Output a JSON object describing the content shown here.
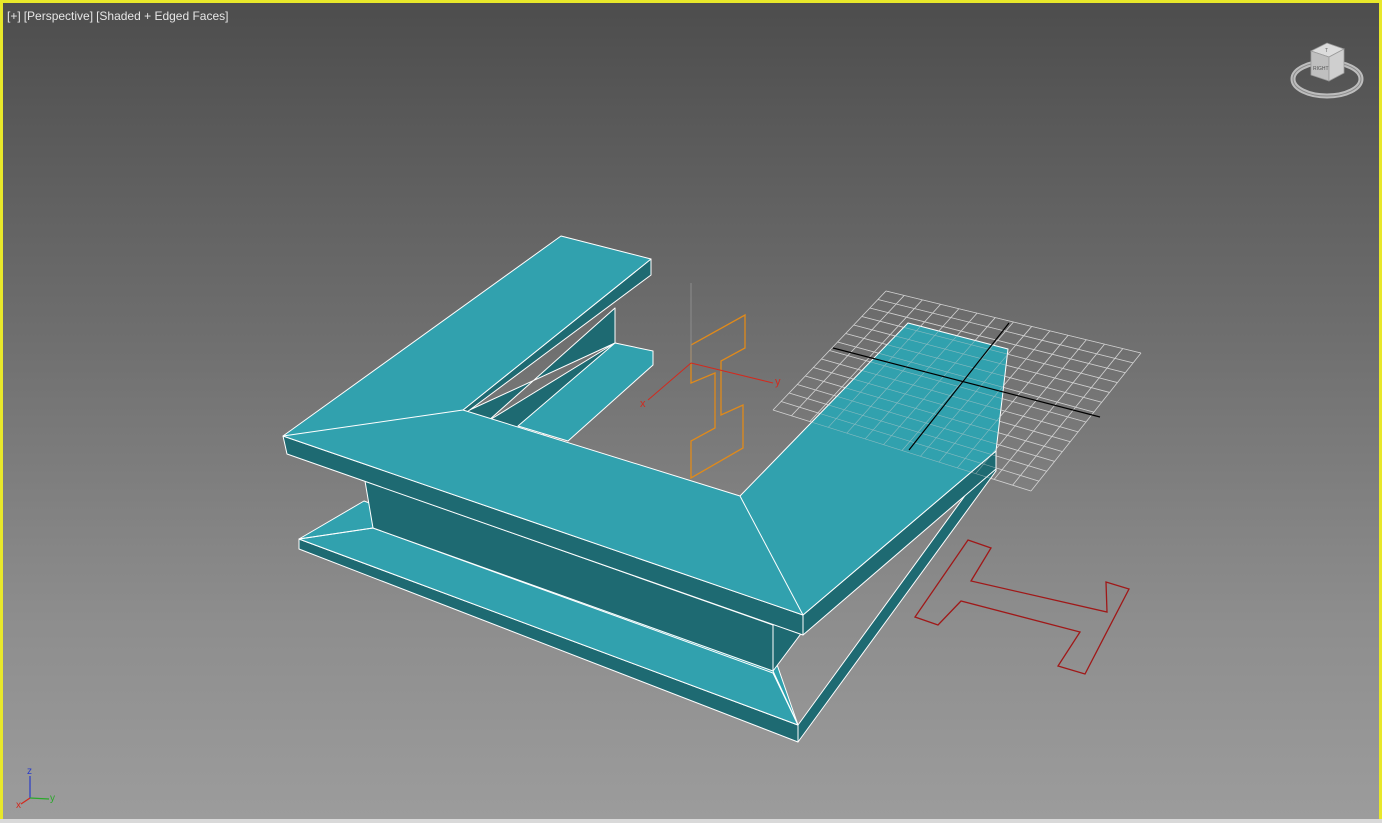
{
  "viewport": {
    "labels": {
      "menu": "[+]",
      "view": "[Perspective]",
      "shading": "[Shaded + Edged Faces]"
    },
    "border_color": "#e8e82a",
    "active": true
  },
  "viewcube": {
    "face_label": "RIGHT",
    "top_label": "T"
  },
  "axis_tripod": {
    "x": "x",
    "y": "y",
    "z": "z"
  },
  "scene": {
    "object_color": "#31a1ae",
    "object_dark_color": "#1e6a72",
    "edge_color": "#ffffff",
    "gizmo_x_color": "#d22a1e",
    "gizmo_y_color": "#d22a1e",
    "profile_selected_color": "#e08a1a",
    "profile_shape_color": "#a01818",
    "grid_color": "#d0d0d0",
    "gizmo_labels": {
      "x": "x",
      "y": "y"
    }
  }
}
